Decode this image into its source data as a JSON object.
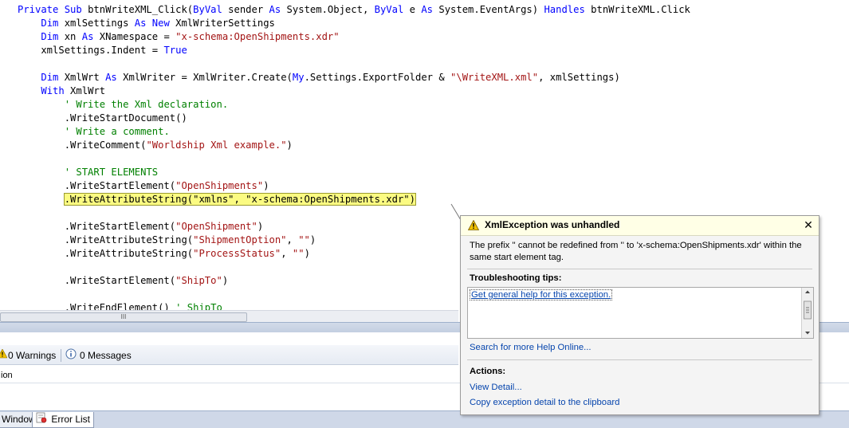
{
  "code": {
    "lines": [
      [
        {
          "t": "Private Sub ",
          "c": "kw"
        },
        {
          "t": "btnWriteXML_Click(",
          "c": ""
        },
        {
          "t": "ByVal",
          "c": "kw"
        },
        {
          "t": " sender ",
          "c": ""
        },
        {
          "t": "As",
          "c": "kw"
        },
        {
          "t": " System.Object, ",
          "c": ""
        },
        {
          "t": "ByVal",
          "c": "kw"
        },
        {
          "t": " e ",
          "c": ""
        },
        {
          "t": "As",
          "c": "kw"
        },
        {
          "t": " System.EventArgs) ",
          "c": ""
        },
        {
          "t": "Handles",
          "c": "kw"
        },
        {
          "t": " btnWriteXML.Click",
          "c": ""
        }
      ],
      [
        {
          "t": "    ",
          "c": ""
        },
        {
          "t": "Dim",
          "c": "kw"
        },
        {
          "t": " xmlSettings ",
          "c": ""
        },
        {
          "t": "As New",
          "c": "kw"
        },
        {
          "t": " XmlWriterSettings",
          "c": ""
        }
      ],
      [
        {
          "t": "    ",
          "c": ""
        },
        {
          "t": "Dim",
          "c": "kw"
        },
        {
          "t": " xn ",
          "c": ""
        },
        {
          "t": "As",
          "c": "kw"
        },
        {
          "t": " XNamespace = ",
          "c": ""
        },
        {
          "t": "\"x-schema:OpenShipments.xdr\"",
          "c": "str"
        }
      ],
      [
        {
          "t": "    xmlSettings.Indent = ",
          "c": ""
        },
        {
          "t": "True",
          "c": "kw"
        }
      ],
      [],
      [
        {
          "t": "    ",
          "c": ""
        },
        {
          "t": "Dim",
          "c": "kw"
        },
        {
          "t": " XmlWrt ",
          "c": ""
        },
        {
          "t": "As",
          "c": "kw"
        },
        {
          "t": " XmlWriter = XmlWriter.Create(",
          "c": ""
        },
        {
          "t": "My",
          "c": "kw"
        },
        {
          "t": ".Settings.ExportFolder & ",
          "c": ""
        },
        {
          "t": "\"\\WriteXML.xml\"",
          "c": "str"
        },
        {
          "t": ", xmlSettings)",
          "c": ""
        }
      ],
      [
        {
          "t": "    ",
          "c": ""
        },
        {
          "t": "With",
          "c": "kw"
        },
        {
          "t": " XmlWrt",
          "c": ""
        }
      ],
      [
        {
          "t": "        ",
          "c": ""
        },
        {
          "t": "' Write the Xml declaration.",
          "c": "cm"
        }
      ],
      [
        {
          "t": "        .WriteStartDocument()",
          "c": ""
        }
      ],
      [
        {
          "t": "        ",
          "c": ""
        },
        {
          "t": "' Write a comment.",
          "c": "cm"
        }
      ],
      [
        {
          "t": "        .WriteComment(",
          "c": ""
        },
        {
          "t": "\"Worldship Xml example.\"",
          "c": "str"
        },
        {
          "t": ")",
          "c": ""
        }
      ],
      [],
      [
        {
          "t": "        ",
          "c": ""
        },
        {
          "t": "' START ELEMENTS",
          "c": "cm"
        }
      ],
      [
        {
          "t": "        .WriteStartElement(",
          "c": ""
        },
        {
          "t": "\"OpenShipments\"",
          "c": "str"
        },
        {
          "t": ")",
          "c": ""
        }
      ],
      [
        {
          "t": "        ",
          "c": ""
        },
        {
          "t": ".WriteAttributeString(\"xmlns\", \"x-schema:OpenShipments.xdr\")",
          "c": "hl"
        }
      ],
      [],
      [
        {
          "t": "        .WriteStartElement(",
          "c": ""
        },
        {
          "t": "\"OpenShipment\"",
          "c": "str"
        },
        {
          "t": ")",
          "c": ""
        }
      ],
      [
        {
          "t": "        .WriteAttributeString(",
          "c": ""
        },
        {
          "t": "\"ShipmentOption\"",
          "c": "str"
        },
        {
          "t": ", ",
          "c": ""
        },
        {
          "t": "\"\"",
          "c": "str"
        },
        {
          "t": ")",
          "c": ""
        }
      ],
      [
        {
          "t": "        .WriteAttributeString(",
          "c": ""
        },
        {
          "t": "\"ProcessStatus\"",
          "c": "str"
        },
        {
          "t": ", ",
          "c": ""
        },
        {
          "t": "\"\"",
          "c": "str"
        },
        {
          "t": ")",
          "c": ""
        }
      ],
      [],
      [
        {
          "t": "        .WriteStartElement(",
          "c": ""
        },
        {
          "t": "\"ShipTo\"",
          "c": "str"
        },
        {
          "t": ")",
          "c": ""
        }
      ],
      [],
      [
        {
          "t": "        .WriteEndElement() ",
          "c": ""
        },
        {
          "t": "' ShipTo",
          "c": "cm"
        }
      ]
    ]
  },
  "hscroll": {
    "thumb_label": "III"
  },
  "error_list": {
    "warnings": "0 Warnings",
    "messages": "0 Messages",
    "column_header": "ion"
  },
  "bottom_tabs": [
    {
      "label": "Window",
      "active": false
    },
    {
      "label": "Error List",
      "active": true
    }
  ],
  "exception": {
    "title": "XmlException was unhandled",
    "close": "✕",
    "message": "The prefix '' cannot be redefined from '' to 'x-schema:OpenShipments.xdr' within the same start element tag.",
    "tips_title": "Troubleshooting tips:",
    "tip_link": "Get general help for this exception.",
    "search_link": "Search for more Help Online...",
    "actions_title": "Actions:",
    "action_view": "View Detail...",
    "action_copy": "Copy exception detail to the clipboard"
  },
  "colors": {
    "keyword": "#0000ff",
    "string": "#a31515",
    "comment": "#008000",
    "highlight": "#fbfb82",
    "link": "#0645ad"
  }
}
